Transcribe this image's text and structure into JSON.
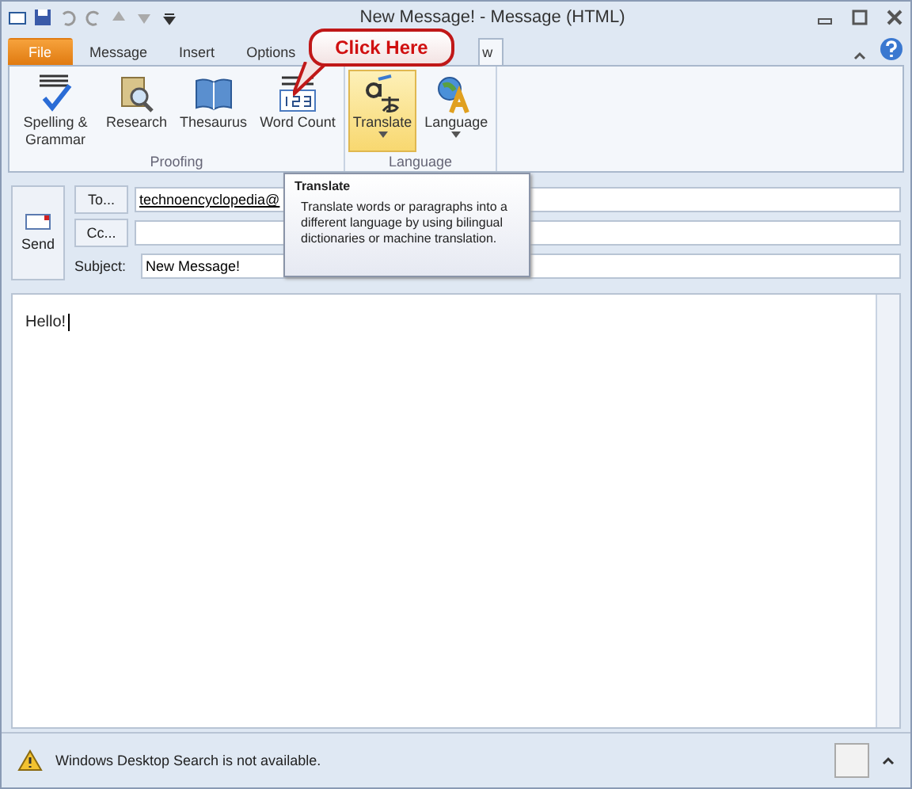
{
  "window": {
    "title": "New Message! - Message (HTML)"
  },
  "tabs": [
    {
      "label": "File",
      "selected": false,
      "kind": "file"
    },
    {
      "label": "Message",
      "selected": false,
      "kind": "tab"
    },
    {
      "label": "Insert",
      "selected": false,
      "kind": "tab"
    },
    {
      "label": "Options",
      "selected": false,
      "kind": "tab"
    },
    {
      "label": "w",
      "selected": true,
      "kind": "tab"
    }
  ],
  "callout": {
    "text": "Click Here"
  },
  "ribbon": {
    "groups": [
      {
        "label": "Proofing",
        "buttons": [
          {
            "label": "Spelling & Grammar",
            "kind": "spelling",
            "highlighted": false,
            "dropdown": false
          },
          {
            "label": "Research",
            "kind": "research",
            "highlighted": false,
            "dropdown": false
          },
          {
            "label": "Thesaurus",
            "kind": "book",
            "highlighted": false,
            "dropdown": false
          },
          {
            "label": "Word Count",
            "kind": "count",
            "highlighted": false,
            "dropdown": false
          }
        ]
      },
      {
        "label": "Language",
        "buttons": [
          {
            "label": "Translate",
            "kind": "translate",
            "highlighted": true,
            "dropdown": true
          },
          {
            "label": "Language",
            "kind": "globe",
            "highlighted": false,
            "dropdown": true
          }
        ]
      }
    ]
  },
  "tooltip": {
    "title": "Translate",
    "text": "Translate words or paragraphs into a different language by using bilingual dictionaries or machine translation."
  },
  "header": {
    "send": "Send",
    "to": {
      "button": "To...",
      "value": "technoencyclopedia@"
    },
    "cc": {
      "button": "Cc..."
    },
    "subject": {
      "label": "Subject:",
      "value": "New Message!"
    }
  },
  "body": {
    "text": "Hello!"
  },
  "status_bar": {
    "message": "Windows Desktop Search is not available."
  }
}
